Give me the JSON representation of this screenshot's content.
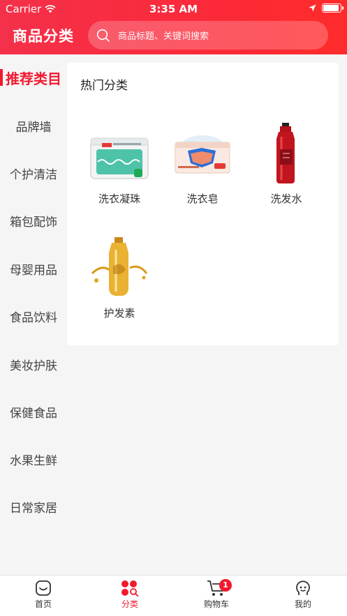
{
  "status_bar": {
    "carrier": "Carrier",
    "time": "3:35 AM"
  },
  "nav": {
    "title": "商品分类",
    "search_placeholder": "商品标题、关键词搜索"
  },
  "sidebar": {
    "items": [
      {
        "label": "推荐类目",
        "active": true
      },
      {
        "label": "品牌墙"
      },
      {
        "label": "个护清洁"
      },
      {
        "label": "箱包配饰"
      },
      {
        "label": "母婴用品"
      },
      {
        "label": "食品饮料"
      },
      {
        "label": "美妆护肤"
      },
      {
        "label": "保健食品"
      },
      {
        "label": "水果生鲜"
      },
      {
        "label": "日常家居"
      }
    ]
  },
  "section": {
    "title": "热门分类",
    "products": [
      {
        "name": "洗衣凝珠",
        "icon": "laundry-pods-image"
      },
      {
        "name": "洗衣皂",
        "icon": "laundry-soap-image"
      },
      {
        "name": "洗发水",
        "icon": "shampoo-bottle-image"
      },
      {
        "name": "护发素",
        "icon": "hair-oil-image"
      }
    ]
  },
  "tabbar": {
    "tabs": [
      {
        "label": "首页",
        "icon": "home-icon"
      },
      {
        "label": "分类",
        "icon": "category-icon",
        "active": true
      },
      {
        "label": "购物车",
        "icon": "cart-icon",
        "badge": "1"
      },
      {
        "label": "我的",
        "icon": "profile-icon"
      }
    ]
  },
  "colors": {
    "accent": "#f2192f",
    "header_start": "#f4304a",
    "header_end": "#ff2b2b"
  }
}
